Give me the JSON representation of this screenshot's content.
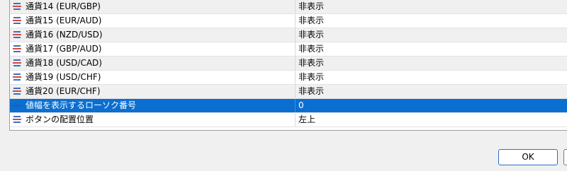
{
  "properties": {
    "rows": [
      {
        "name": "通貨14 (EUR/GBP)",
        "value": "非表示",
        "icon": "property-list-icon",
        "selected": false
      },
      {
        "name": "通貨15 (EUR/AUD)",
        "value": "非表示",
        "icon": "property-list-icon",
        "selected": false
      },
      {
        "name": "通貨16 (NZD/USD)",
        "value": "非表示",
        "icon": "property-list-icon",
        "selected": false
      },
      {
        "name": "通貨17 (GBP/AUD)",
        "value": "非表示",
        "icon": "property-list-icon",
        "selected": false
      },
      {
        "name": "通貨18 (USD/CAD)",
        "value": "非表示",
        "icon": "property-list-icon",
        "selected": false
      },
      {
        "name": "通貨19 (USD/CHF)",
        "value": "非表示",
        "icon": "property-list-icon",
        "selected": false
      },
      {
        "name": "通貨20 (EUR/CHF)",
        "value": "非表示",
        "icon": "property-list-icon",
        "selected": false
      },
      {
        "name": "値幅を表示するローソク番号",
        "value": "0",
        "icon": "numeric-value-icon",
        "selected": true
      },
      {
        "name": "ボタンの配置位置",
        "value": "左上",
        "icon": "property-list-icon",
        "selected": false
      }
    ]
  },
  "buttons": {
    "ok_label": "OK"
  },
  "colors": {
    "selection": "#0a6fd1",
    "alt_row": "#f0f0f0",
    "icon_red": "#d9453c",
    "icon_blue": "#3a6fc4"
  }
}
